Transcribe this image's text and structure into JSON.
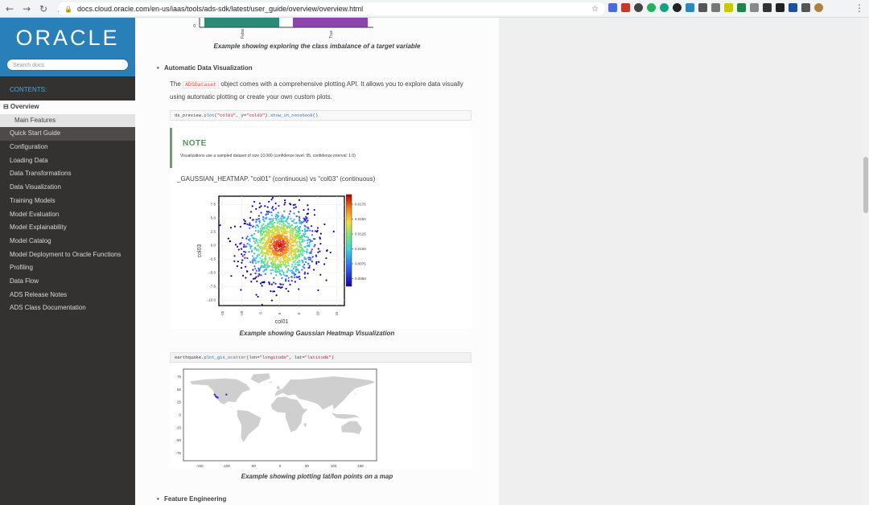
{
  "browser": {
    "url": "docs.cloud.oracle.com/en-us/iaas/tools/ads-sdk/latest/user_guide/overview/overview.html"
  },
  "sidebar": {
    "logo": "ORACLE",
    "search_placeholder": "Search docs",
    "contents_caption": "CONTENTS:",
    "current": "⊟ Overview",
    "sub": "Main Features",
    "items": [
      "Quick Start Guide",
      "Configuration",
      "Loading Data",
      "Data Transformations",
      "Data Visualization",
      "Training Models",
      "Model Evaluation",
      "Model Explainability",
      "Model Catalog",
      "Model Deployment to Oracle Functions",
      "Profiling",
      "Data Flow",
      "ADS Release Notes",
      "ADS Class Documentation"
    ]
  },
  "content": {
    "top_bar_ticks": [
      "0",
      "False",
      "True"
    ],
    "caption_class_imbalance": "Example showing exploring the class imbalance of a target variable",
    "section_auto_viz": "Automatic Data Visualization",
    "para_the": "The",
    "para_code": "ADSDataset",
    "para_rest": "object comes with a comprehensive plotting API. It allows you to explore data visually using automatic plotting or create your own custom plots.",
    "code1_parts": [
      "ds_preview.",
      "plot",
      "(",
      "\"col01\"",
      ", y=",
      "\"col03\"",
      ").",
      "show_in_notebook",
      "()"
    ],
    "note_title": "NOTE",
    "note_text": "Visualizations use a sampled dataset of size 10,000 (confidence level: 95, confidence interval: 1.0)",
    "heatmap_title": "_GAUSSIAN_HEATMAP. \"col01\" (continuous) vs \"col03\" (continuous)",
    "caption_heatmap": "Example showing Gaussian Heatmap Visualization",
    "code2_parts": [
      "earthquake.",
      "plot_gis_scatter",
      "(lon=",
      "\"longitude\"",
      ", lat=",
      "\"latitude\"",
      ")"
    ],
    "caption_map": "Example showing plotting lat/lon points on a map",
    "section_feature_eng": "Feature Engineering"
  },
  "chart_data": [
    {
      "type": "scatter",
      "title": "",
      "xlabel": "col01",
      "ylabel": "col03",
      "xticks": [
        "-15",
        "-10",
        "-5",
        "0",
        "5",
        "10",
        "15"
      ],
      "yticks": [
        "7.5",
        "5.0",
        "2.5",
        "0.0",
        "-2.5",
        "-5.0",
        "-7.5",
        "-10.0"
      ],
      "xlim": [
        -16,
        17
      ],
      "ylim": [
        -11,
        9
      ],
      "colorbar_ticks": [
        "0.0175",
        "0.0150",
        "0.0125",
        "0.0100",
        "0.0075",
        "0.0050",
        "0.0025"
      ],
      "grid": true,
      "distribution": "gaussian, centered near (0, 0)"
    },
    {
      "type": "scatter",
      "title": "",
      "xticks": [
        "-150",
        "-100",
        "-50",
        "0",
        "50",
        "100",
        "150"
      ],
      "yticks": [
        "75",
        "50",
        "25",
        "0",
        "-25",
        "-50",
        "-75"
      ],
      "points": [
        {
          "x": -122,
          "y": 40
        },
        {
          "x": -118,
          "y": 35
        },
        {
          "x": -116,
          "y": 34
        },
        {
          "x": -100,
          "y": 40
        },
        {
          "x": -120,
          "y": 37
        }
      ]
    }
  ]
}
